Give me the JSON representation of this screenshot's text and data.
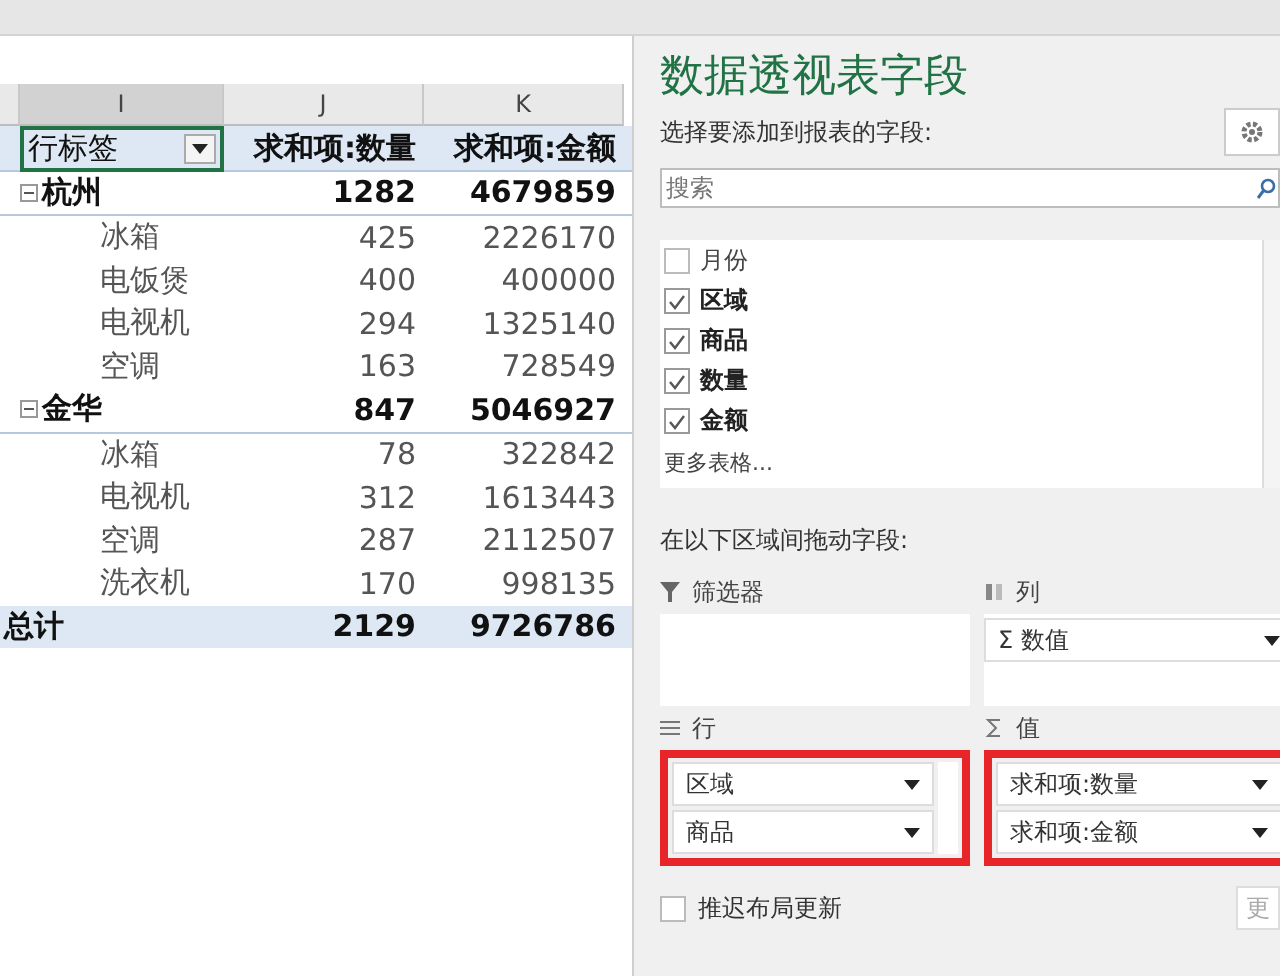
{
  "sheet": {
    "columns": [
      {
        "label": "I",
        "selected": true
      },
      {
        "label": "J",
        "selected": false
      },
      {
        "label": "K",
        "selected": false
      }
    ],
    "header": {
      "label": "行标签",
      "sum_qty": "求和项:数量",
      "sum_amount": "求和项:金额"
    },
    "rows": [
      {
        "kind": "group",
        "label": "杭州",
        "expanded": true,
        "qty": "1282",
        "amount": "4679859"
      },
      {
        "kind": "item",
        "label": "冰箱",
        "qty": "425",
        "amount": "2226170"
      },
      {
        "kind": "item",
        "label": "电饭煲",
        "qty": "400",
        "amount": "400000"
      },
      {
        "kind": "item",
        "label": "电视机",
        "qty": "294",
        "amount": "1325140"
      },
      {
        "kind": "item",
        "label": "空调",
        "qty": "163",
        "amount": "728549"
      },
      {
        "kind": "group",
        "label": "金华",
        "expanded": true,
        "qty": "847",
        "amount": "5046927"
      },
      {
        "kind": "item",
        "label": "冰箱",
        "qty": "78",
        "amount": "322842"
      },
      {
        "kind": "item",
        "label": "电视机",
        "qty": "312",
        "amount": "1613443"
      },
      {
        "kind": "item",
        "label": "空调",
        "qty": "287",
        "amount": "2112507"
      },
      {
        "kind": "item",
        "label": "洗衣机",
        "qty": "170",
        "amount": "998135"
      },
      {
        "kind": "total",
        "label": "总计",
        "qty": "2129",
        "amount": "9726786"
      }
    ]
  },
  "pane": {
    "title": "数据透视表字段",
    "subtitle": "选择要添加到报表的字段:",
    "search": {
      "placeholder": "搜索"
    },
    "fields": [
      {
        "label": "月份",
        "checked": false
      },
      {
        "label": "区域",
        "checked": true
      },
      {
        "label": "商品",
        "checked": true
      },
      {
        "label": "数量",
        "checked": true
      },
      {
        "label": "金额",
        "checked": true
      }
    ],
    "more_tables": "更多表格...",
    "areas_label": "在以下区域间拖动字段:",
    "filters": {
      "title": "筛选器"
    },
    "columns": {
      "title": "列",
      "items": [
        "Σ 数值"
      ]
    },
    "rows": {
      "title": "行",
      "items": [
        "区域",
        "商品"
      ]
    },
    "values": {
      "title": "值",
      "items": [
        "求和项:数量",
        "求和项:金额"
      ]
    },
    "defer": {
      "label": "推迟布局更新",
      "checked": false
    },
    "update_button": "更"
  }
}
